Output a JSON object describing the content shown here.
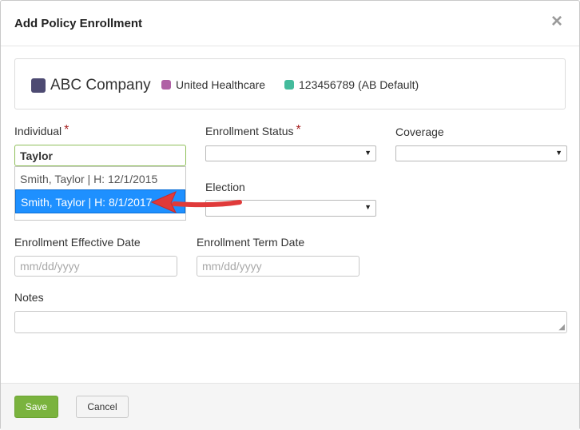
{
  "dialog": {
    "title": "Add Policy Enrollment",
    "close_symbol": "×"
  },
  "policy": {
    "company": {
      "name": "ABC Company",
      "color": "#4d4a72"
    },
    "carrier": {
      "name": "United Healthcare",
      "color": "#b061a5"
    },
    "plan": {
      "name": "123456789 (AB Default)",
      "color": "#44bb9c"
    }
  },
  "fields": {
    "individual": {
      "label": "Individual",
      "value": "Taylor"
    },
    "enrollment_status": {
      "label": "Enrollment Status",
      "value": ""
    },
    "coverage": {
      "label": "Coverage",
      "value": ""
    },
    "election": {
      "label": "Election",
      "value": ""
    },
    "effective_date": {
      "label": "Enrollment Effective Date",
      "placeholder": "mm/dd/yyyy"
    },
    "term_date": {
      "label": "Enrollment Term Date",
      "placeholder": "mm/dd/yyyy"
    },
    "notes": {
      "label": "Notes",
      "value": ""
    }
  },
  "required_marker": "*",
  "autocomplete": {
    "items": [
      {
        "label": "Smith, Taylor | H: 12/1/2015"
      },
      {
        "label": "Smith, Taylor | H: 8/1/2017",
        "selected": true
      }
    ]
  },
  "footer": {
    "save_label": "Save",
    "cancel_label": "Cancel"
  },
  "colors": {
    "save": "#7ab33e",
    "selection": "#1e90ff",
    "annotation_arrow": "#e03a3a",
    "required": "#a51c1c"
  }
}
